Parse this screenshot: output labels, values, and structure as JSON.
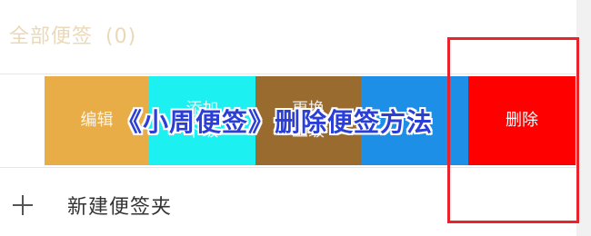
{
  "header": {
    "title": "全部便签",
    "count": "(0)"
  },
  "actions": {
    "edit": "编辑",
    "add_sub": [
      "添加",
      "下级"
    ],
    "move_up": [
      "更换",
      "上级"
    ],
    "delete": "删除"
  },
  "overlay_title": "《小周便签》删除便签方法",
  "new_folder": {
    "icon": "plus-icon",
    "label": "新建便签夹"
  },
  "colors": {
    "edit": "#e8ad47",
    "add_sub": "#1cf0f0",
    "move_up": "#9a6b2f",
    "blue": "#1e8fe6",
    "delete": "#ff0000",
    "highlight_border": "#e8232c",
    "overlay_text": "#2b3fd6"
  }
}
